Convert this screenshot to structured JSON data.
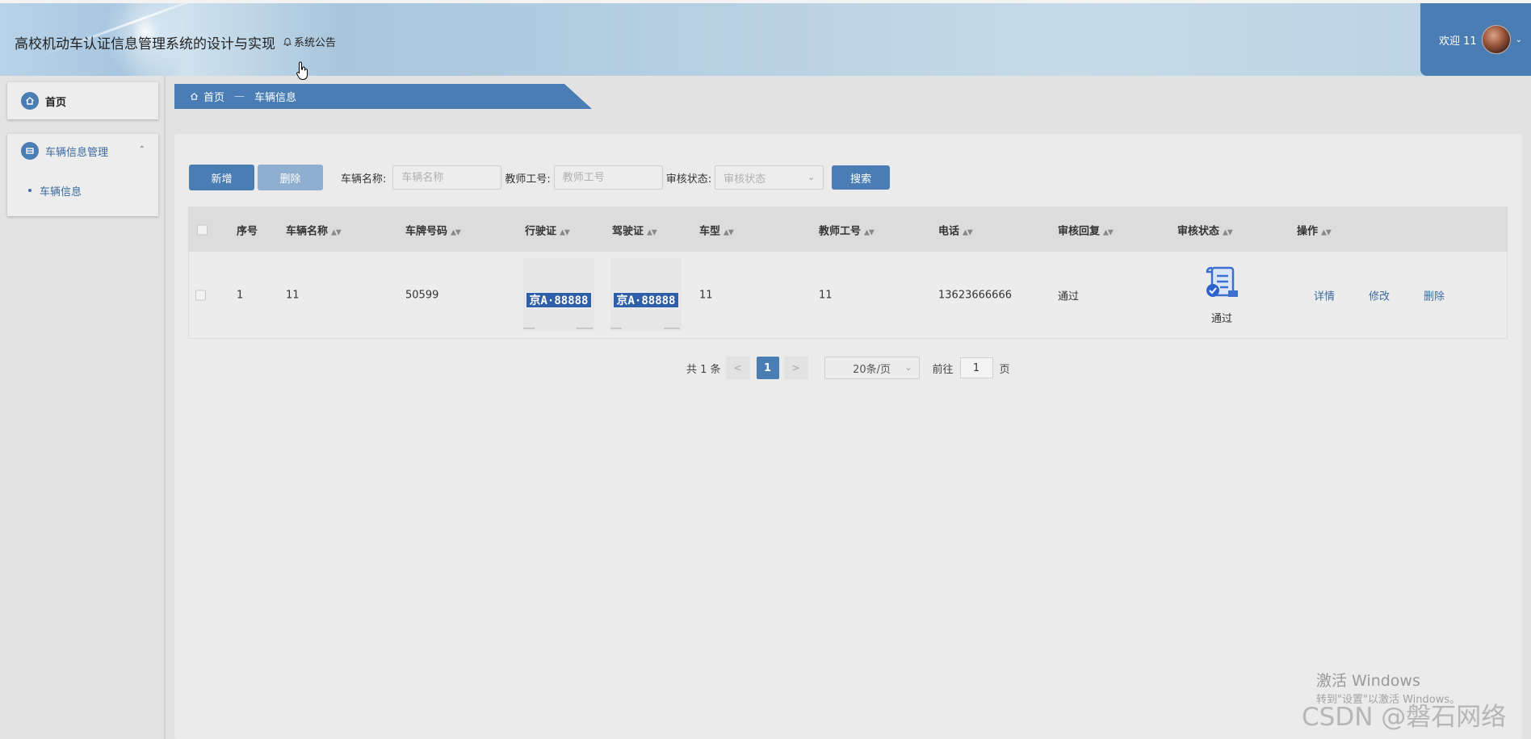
{
  "header": {
    "title": "高校机动车认证信息管理系统的设计与实现",
    "notice_label": "系统公告",
    "welcome": "欢迎 11"
  },
  "sidebar": {
    "home_label": "首页",
    "menu_label": "车辆信息管理",
    "sub_label": "车辆信息"
  },
  "breadcrumb": {
    "home": "首页",
    "current": "车辆信息"
  },
  "toolbar": {
    "add_label": "新增",
    "delete_label": "删除",
    "vehicle_name_label": "车辆名称:",
    "vehicle_name_placeholder": "车辆名称",
    "teacher_id_label": "教师工号:",
    "teacher_id_placeholder": "教师工号",
    "status_label": "审核状态:",
    "status_placeholder": "审核状态",
    "search_label": "搜索"
  },
  "table": {
    "headers": [
      "序号",
      "车辆名称",
      "车牌号码",
      "行驶证",
      "驾驶证",
      "车型",
      "教师工号",
      "电话",
      "审核回复",
      "审核状态",
      "操作"
    ],
    "row": {
      "index": "1",
      "vehicle_name": "11",
      "plate_number": "50599",
      "license_plate_text": "京A·88888",
      "driver_plate_text": "京A·88888",
      "vehicle_type": "11",
      "teacher_id": "11",
      "phone": "13623666666",
      "reply": "通过",
      "status": "通过",
      "action_detail": "详情",
      "action_edit": "修改",
      "action_delete": "删除"
    }
  },
  "pagination": {
    "total": "共 1 条",
    "prev": "<",
    "current_page": "1",
    "next": ">",
    "page_size": "20条/页",
    "goto_label": "前往",
    "goto_value": "1",
    "page_suffix": "页"
  },
  "watermark": {
    "activate": "激活 Windows",
    "activate_hint": "转到\"设置\"以激活 Windows。",
    "csdn": "CSDN @磐石网络"
  },
  "colors": {
    "primary": "#4a7db3",
    "primary_light": "#8fafd0",
    "link": "#3b6aa0"
  }
}
